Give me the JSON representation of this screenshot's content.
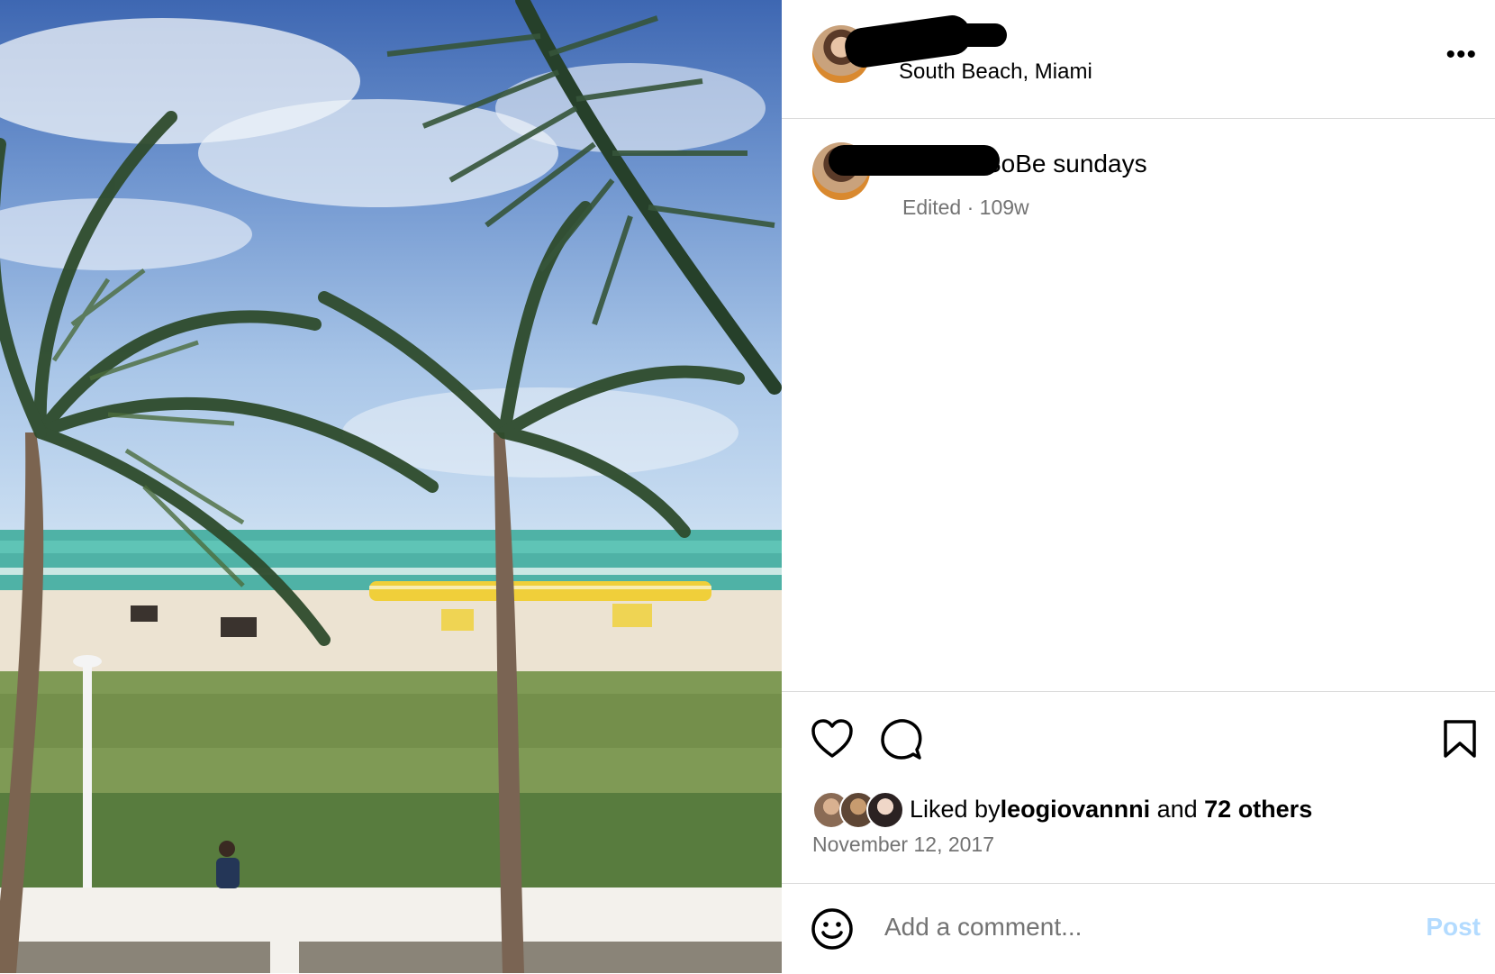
{
  "post": {
    "location": "South Beach, Miami",
    "caption": "SoBe sundays",
    "caption_meta": "Edited · 109w",
    "more_label": "•••",
    "liked_by_prefix": "Liked by ",
    "liked_by_user": "leogiovannni",
    "liked_by_and": " and ",
    "liked_by_others": "72 others",
    "date": "November 12, 2017"
  },
  "comment": {
    "placeholder": "Add a comment...",
    "post_label": "Post"
  },
  "icons": {
    "like": "heart-icon",
    "comment": "comment-bubble-icon",
    "save": "bookmark-icon",
    "emoji": "smiley-icon",
    "more": "more-options-icon"
  },
  "colors": {
    "post_button_disabled": "#b3dbff",
    "secondary_text": "#737373",
    "divider": "#dbdbdb"
  }
}
